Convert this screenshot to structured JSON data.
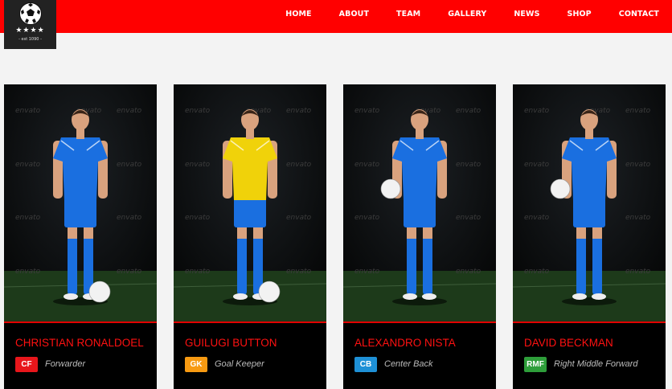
{
  "logo": {
    "stars": "★★★★",
    "est": "- est 1090 -"
  },
  "nav": [
    "HOME",
    "ABOUT",
    "TEAM",
    "GALLERY",
    "NEWS",
    "SHOP",
    "CONTACT"
  ],
  "players": [
    {
      "name": "CHRISTIAN RONALDOEL",
      "badge": "CF",
      "position": "Forwarder",
      "badge_color": "#e8161b",
      "shirt": "#1a6fe0",
      "shorts": "#1a6fe0"
    },
    {
      "name": "GUILUGI BUTTON",
      "badge": "GK",
      "position": "Goal Keeper",
      "badge_color": "#f79a12",
      "shirt": "#f0d20a",
      "shorts": "#1a6fe0"
    },
    {
      "name": "ALEXANDRO NISTA",
      "badge": "CB",
      "position": "Center Back",
      "badge_color": "#1e90d6",
      "shirt": "#1a6fe0",
      "shorts": "#1a6fe0"
    },
    {
      "name": "DAVID BECKMAN",
      "badge": "RMF",
      "position": "Right Middle Forward",
      "badge_color": "#2e9e3a",
      "shirt": "#1a6fe0",
      "shorts": "#1a6fe0"
    }
  ],
  "watermark": "envato"
}
